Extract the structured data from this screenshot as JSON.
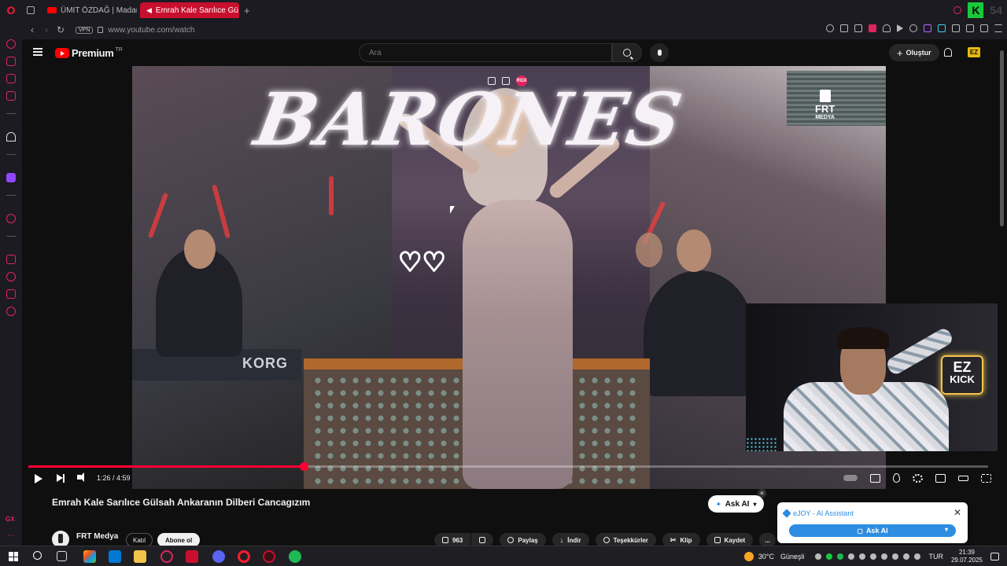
{
  "browser": {
    "tabs": [
      {
        "label": "ÜMIT ÖZDAĞ | Madara Od"
      },
      {
        "label": "Emrah Kale Sarılıce Gü"
      }
    ],
    "new_tab": "+",
    "url": "www.youtube.com/watch",
    "vpn": "VPN",
    "gx_badge": "K",
    "gx_num": "54"
  },
  "youtube": {
    "logo": "Premium",
    "logo_country": "TR",
    "search_placeholder": "Ara",
    "create_label": "Oluştur",
    "avatar_label": "EZ"
  },
  "video": {
    "sign_text": "BARONES",
    "keyboard_brand": "KORG",
    "overlay_badge": "RGX",
    "watermark": {
      "line1": "FRT",
      "line2": "MEDYA"
    },
    "time": "1:26 / 4:59",
    "progress_fraction": 0.287,
    "webcam": {
      "sign_ez": "EZ",
      "sign_kick": "KICK"
    }
  },
  "meta": {
    "title": "Emrah Kale Sarılıce Gülsah Ankaranın Dilberi Cancagızım",
    "ask_ai": "Ask AI",
    "channel": "FRT Medya",
    "join": "Katıl",
    "subscribe": "Abone ol",
    "likes": "963",
    "actions": {
      "share": "Paylaş",
      "download": "İndir",
      "thanks": "Teşekkürler",
      "clip": "Klip",
      "save": "Kaydet",
      "more": "..."
    }
  },
  "ejoy": {
    "title": "eJOY - AI Assistant",
    "button": "Ask AI",
    "close": "✕"
  },
  "sidebar": {
    "gx_label": "GX"
  },
  "taskbar": {
    "weather": "30°C",
    "weather_desc": "Güneşli",
    "lang": "TUR",
    "time": "21:39",
    "date": "29.07.2025"
  }
}
